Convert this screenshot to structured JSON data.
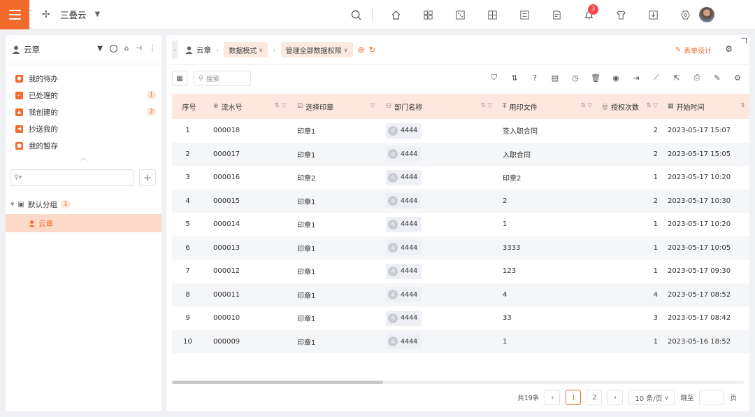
{
  "colors": {
    "accent": "#f26b2c",
    "header_bg": "#fde7de",
    "badge_red": "#f5484b"
  },
  "topbar": {
    "brand": "三叠云",
    "notification_count": "3",
    "icons": [
      "search-icon",
      "home-icon",
      "apps-icon",
      "dice-icon",
      "grid-plus-icon",
      "list-icon",
      "document-icon",
      "bell-icon",
      "shirt-icon",
      "download-icon",
      "settings-hex-icon",
      "user-avatar"
    ]
  },
  "left": {
    "user": "云章",
    "tasks": [
      {
        "label": "我的待办",
        "count": ""
      },
      {
        "label": "已处理的",
        "count": "1"
      },
      {
        "label": "我创建的",
        "count": "2"
      },
      {
        "label": "抄送我的",
        "count": ""
      },
      {
        "label": "我的暂存",
        "count": ""
      }
    ],
    "search_placeholder": "",
    "group": {
      "label": "默认分组",
      "count": "1"
    },
    "selected_item": "云章"
  },
  "main": {
    "breadcrumb": {
      "root": "云章",
      "mode": "数据模式",
      "scope": "管理全部数据权限"
    },
    "form_design": "表单设计",
    "search_placeholder": "搜索",
    "columns": [
      "序号",
      "流水号",
      "选择印章",
      "部门名称",
      "用印文件",
      "授权次数",
      "开始时间"
    ],
    "rows": [
      {
        "idx": "1",
        "serial": "000018",
        "seal": "印章1",
        "dept": "4444",
        "file": "签入职合同",
        "count": "2",
        "start": "2023-05-17 15:07"
      },
      {
        "idx": "2",
        "serial": "000017",
        "seal": "印章1",
        "dept": "4444",
        "file": "入职合同",
        "count": "2",
        "start": "2023-05-17 15:05"
      },
      {
        "idx": "3",
        "serial": "000016",
        "seal": "印章2",
        "dept": "4444",
        "file": "印章2",
        "count": "1",
        "start": "2023-05-17 10:20"
      },
      {
        "idx": "4",
        "serial": "000015",
        "seal": "印章1",
        "dept": "4444",
        "file": "2",
        "count": "2",
        "start": "2023-05-17 10:30"
      },
      {
        "idx": "5",
        "serial": "000014",
        "seal": "印章1",
        "dept": "4444",
        "file": "1",
        "count": "1",
        "start": "2023-05-17 10:20"
      },
      {
        "idx": "6",
        "serial": "000013",
        "seal": "印章1",
        "dept": "4444",
        "file": "3333",
        "count": "1",
        "start": "2023-05-17 10:05"
      },
      {
        "idx": "7",
        "serial": "000012",
        "seal": "印章1",
        "dept": "4444",
        "file": "123",
        "count": "1",
        "start": "2023-05-17 09:30"
      },
      {
        "idx": "8",
        "serial": "000011",
        "seal": "印章1",
        "dept": "4444",
        "file": "4",
        "count": "4",
        "start": "2023-05-17 08:52"
      },
      {
        "idx": "9",
        "serial": "000010",
        "seal": "印章1",
        "dept": "4444",
        "file": "33",
        "count": "3",
        "start": "2023-05-17 08:42"
      },
      {
        "idx": "10",
        "serial": "000009",
        "seal": "印章1",
        "dept": "4444",
        "file": "1",
        "count": "1",
        "start": "2023-05-16 18:52"
      }
    ],
    "pager": {
      "total": "共19条",
      "pages": [
        "1",
        "2"
      ],
      "page_size": "10 条/页",
      "jump": "跳至",
      "page_unit": "页"
    }
  }
}
